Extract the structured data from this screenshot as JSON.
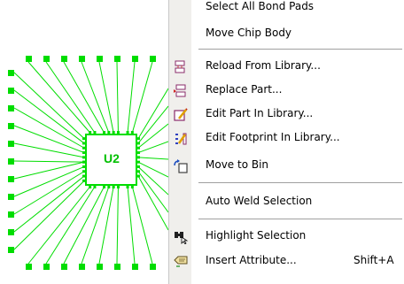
{
  "canvas": {
    "component_label": "U2",
    "accent_color": "#00dd00"
  },
  "menu": {
    "items": [
      {
        "label": "Select All Bond Pads",
        "icon": null
      },
      {
        "label": "Move Chip Body",
        "icon": null
      },
      {
        "label": "Reload From Library...",
        "icon": "reload-library-icon"
      },
      {
        "label": "Replace Part...",
        "icon": "replace-part-icon"
      },
      {
        "label": "Edit Part In Library...",
        "icon": "edit-part-icon"
      },
      {
        "label": "Edit Footprint In Library...",
        "icon": "edit-footprint-icon"
      },
      {
        "label": "Move to Bin",
        "icon": "move-to-bin-icon"
      },
      {
        "label": "Auto Weld Selection",
        "icon": null
      },
      {
        "label": "Highlight Selection",
        "icon": "highlight-icon"
      },
      {
        "label": "Insert Attribute...",
        "icon": "insert-attribute-icon",
        "shortcut": "Shift+A"
      }
    ]
  }
}
